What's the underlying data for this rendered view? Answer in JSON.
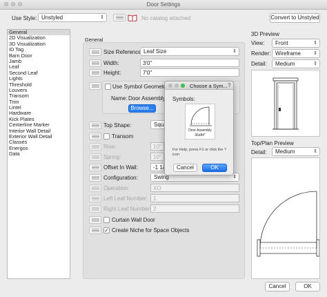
{
  "window": {
    "title": "Door Settings"
  },
  "top": {
    "use_style_label": "Use Style:",
    "use_style_value": "Unstyled",
    "catalog_text": "No catalog attached",
    "convert_button": "Convert to Unstyled"
  },
  "sidebar": {
    "items": [
      "General",
      "2D Visualization",
      "3D Visualization",
      "ID Tag",
      "Barn Door",
      "Jamb",
      "Leaf",
      "Second Leaf",
      "Lights",
      "Threshold",
      "Louvers",
      "Transom",
      "Trim",
      "Lintel",
      "Hardware",
      "Kick Plates",
      "Centerline Marker",
      "Interior Wall Detail",
      "Exterior Wall Detail",
      "Classes",
      "Energos",
      "Data"
    ],
    "selected": "General"
  },
  "general": {
    "heading": "General",
    "size_reference_label": "Size Reference:",
    "size_reference_value": "Leaf Size",
    "width_label": "Width:",
    "width_value": "3'0\"",
    "height_label": "Height:",
    "height_value": "7'0\"",
    "use_symbol_geometry": "Use Symbol Geometry",
    "name_label": "Name:",
    "name_value": "Door Assembly",
    "browse_button": "Browse...",
    "top_shape_label": "Top Shape:",
    "top_shape_value": "Squar",
    "transom_label": "Transom",
    "rise_label": "Rise:",
    "rise_value": "10\"",
    "spring_label": "Spring:",
    "spring_value": "10\"",
    "offset_label": "Offset In Wall:",
    "offset_value": "-1 1/2\"",
    "configuration_label": "Configuration:",
    "configuration_value": "Swing",
    "operation_label": "Operation:",
    "operation_value": "XO",
    "left_leaf_label": "Left Leaf Number:",
    "left_leaf_value": "1",
    "right_leaf_label": "Right Leaf Number:",
    "right_leaf_value": "2",
    "curtain_wall_label": "Curtain Wall Door",
    "niche_label": "Create Niche for Space Objects"
  },
  "preview3d": {
    "heading": "3D Preview",
    "view_label": "View:",
    "view_value": "Front",
    "render_label": "Render:",
    "render_value": "Wireframe",
    "detail_label": "Detail:",
    "detail_value": "Medium"
  },
  "preview2d": {
    "heading": "Top/Plan Preview",
    "detail_label": "Detail:",
    "detail_value": "Medium"
  },
  "dialog": {
    "title": "Choose a Sym...",
    "symbols_label": "Symbols:",
    "symbol_name": "Door Assembly",
    "symbol_size": "36x84\"",
    "help_text": "For Help, press F1 or click the ? icon",
    "cancel_button": "Cancel",
    "ok_button": "OK"
  },
  "footer": {
    "cancel_button": "Cancel",
    "ok_button": "OK"
  },
  "colors": {
    "accent_blue": "#2a7ff0",
    "selected_row": "#d9d9d9"
  }
}
